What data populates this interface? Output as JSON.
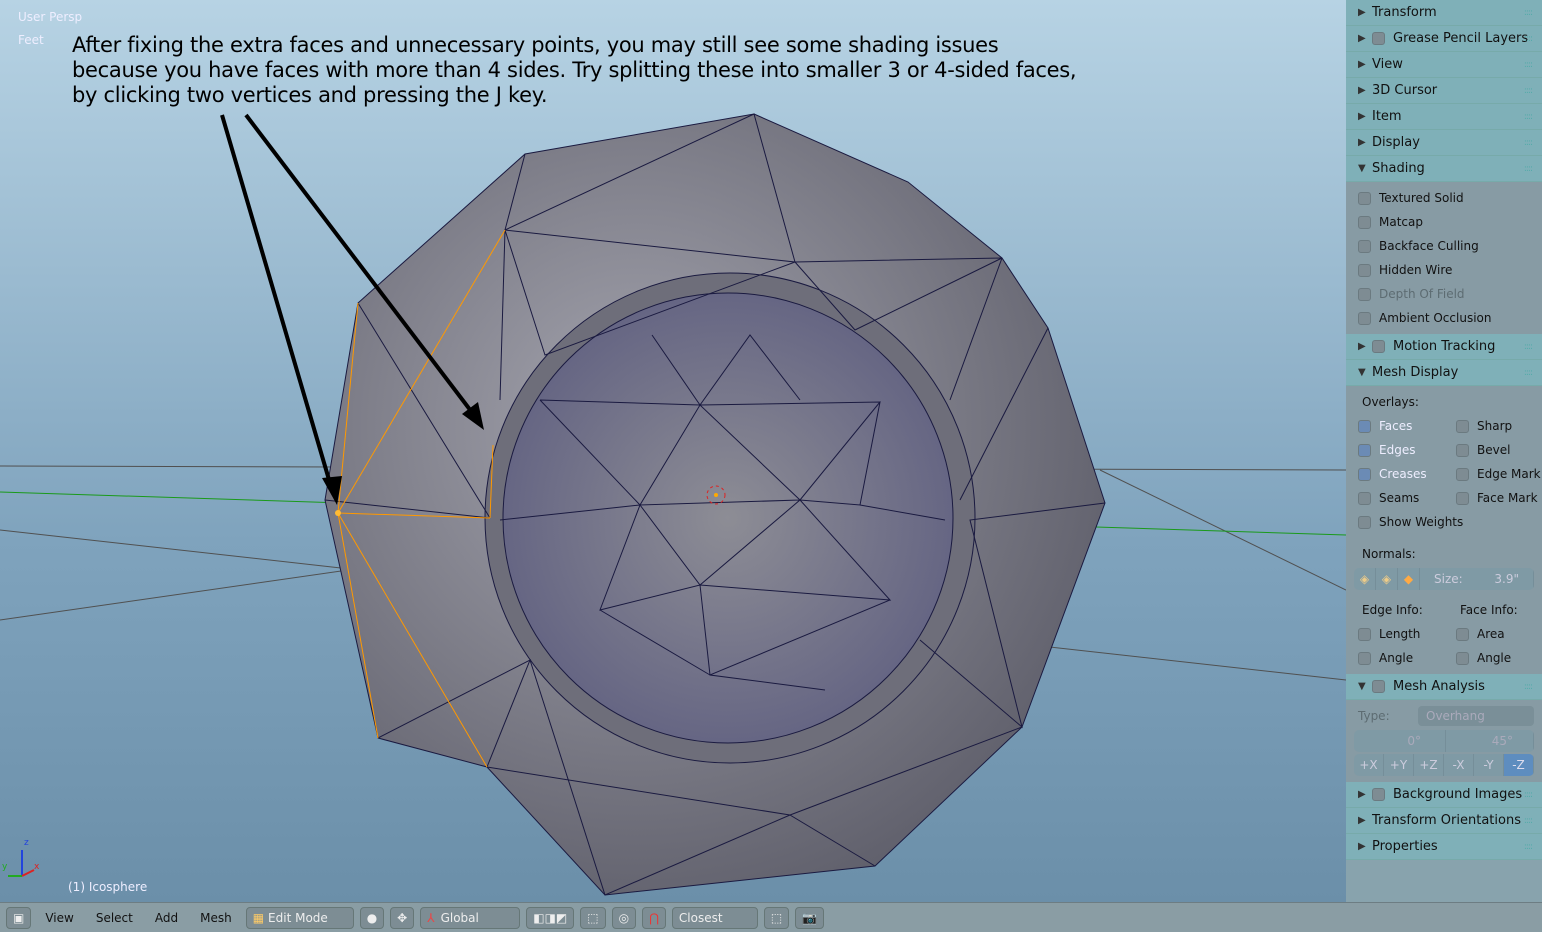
{
  "viewport": {
    "view_name": "User Persp",
    "units": "Feet",
    "object_label": "(1) Icosphere",
    "axis_labels": {
      "z": "z",
      "y": "y",
      "x": "x"
    },
    "annotation": [
      "After fixing the extra faces and unnecessary points, you may still see some shading issues",
      "because you have faces with more than 4 sides. Try splitting these into smaller 3 or 4-sided faces,",
      "by clicking two vertices and pressing the J key."
    ]
  },
  "panel": {
    "headers_top": [
      {
        "label": "Transform",
        "expanded": false,
        "checkbox": false
      },
      {
        "label": "Grease Pencil Layers",
        "expanded": false,
        "checkbox": true
      },
      {
        "label": "View",
        "expanded": false,
        "checkbox": false
      },
      {
        "label": "3D Cursor",
        "expanded": false,
        "checkbox": false
      },
      {
        "label": "Item",
        "expanded": false,
        "checkbox": false
      },
      {
        "label": "Display",
        "expanded": false,
        "checkbox": false
      },
      {
        "label": "Shading",
        "expanded": true,
        "checkbox": false
      }
    ],
    "shading": [
      {
        "label": "Textured Solid",
        "checked": false
      },
      {
        "label": "Matcap",
        "checked": false
      },
      {
        "label": "Backface Culling",
        "checked": false
      },
      {
        "label": "Hidden Wire",
        "checked": false
      },
      {
        "label": "Depth Of Field",
        "checked": false,
        "disabled": true
      },
      {
        "label": "Ambient Occlusion",
        "checked": false
      }
    ],
    "motion_tracking": "Motion Tracking",
    "mesh_display": "Mesh Display",
    "overlays_label": "Overlays:",
    "overlays": [
      [
        "Faces",
        "Sharp"
      ],
      [
        "Edges",
        "Bevel"
      ],
      [
        "Creases",
        "Edge Mark"
      ],
      [
        "Seams",
        "Face Mark"
      ]
    ],
    "show_weights": "Show Weights",
    "normals_label": "Normals:",
    "size_label": "Size:",
    "size_value": "3.9\"",
    "edge_info": "Edge Info:",
    "face_info": "Face Info:",
    "edge_items": [
      "Length",
      "Angle"
    ],
    "face_items": [
      "Area",
      "Angle"
    ],
    "mesh_analysis": "Mesh Analysis",
    "type_label": "Type:",
    "type_value": "Overhang",
    "range_min": "0°",
    "range_max": "45°",
    "axes": [
      "+X",
      "+Y",
      "+Z",
      "-X",
      "-Y",
      "-Z"
    ],
    "active_axis": "-Z",
    "headers_bottom": [
      {
        "label": "Background Images",
        "checkbox": true
      },
      {
        "label": "Transform Orientations",
        "checkbox": false
      },
      {
        "label": "Properties",
        "checkbox": false
      }
    ]
  },
  "bottombar": {
    "menus": [
      "View",
      "Select",
      "Add",
      "Mesh"
    ],
    "mode": "Edit Mode",
    "orientation": "Global",
    "snap": "Closest"
  },
  "colors": {
    "selected": "#ff9900",
    "mesh": "#8a8a96",
    "wire": "#1a1a40",
    "panel": "#88a3ad",
    "header": "#7fb0b8"
  }
}
